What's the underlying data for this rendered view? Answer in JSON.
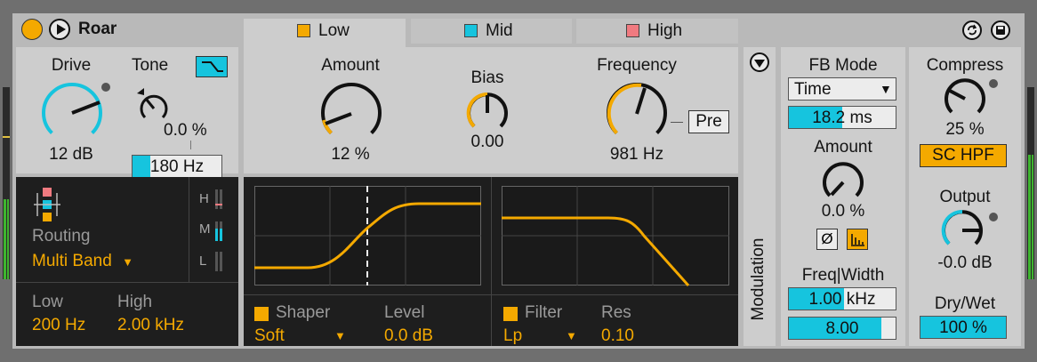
{
  "device": {
    "title": "Roar",
    "colors": {
      "accent_orange": "#f4a900",
      "accent_cyan": "#16c4de",
      "low": "#f4a900",
      "mid": "#16c4de",
      "high": "#f07a80"
    }
  },
  "tabs": [
    {
      "label": "Low",
      "color": "#f4a900"
    },
    {
      "label": "Mid",
      "color": "#16c4de"
    },
    {
      "label": "High",
      "color": "#f07a80"
    }
  ],
  "drive": {
    "label": "Drive",
    "value": "12 dB",
    "level": 0.72
  },
  "tone": {
    "label": "Tone",
    "value": "0.0 %",
    "freq": "180 Hz",
    "freq_level": 0.18
  },
  "band": {
    "amount": {
      "label": "Amount",
      "value": "12 %",
      "level": 0.12
    },
    "bias": {
      "label": "Bias",
      "value": "0.00"
    },
    "frequency": {
      "label": "Frequency",
      "value": "981 Hz",
      "level": 0.55
    },
    "pre_label": "Pre"
  },
  "routing": {
    "label": "Routing",
    "value": "Multi Band",
    "meters": [
      "H",
      "M",
      "L"
    ],
    "low_label": "Low",
    "low_value": "200 Hz",
    "high_label": "High",
    "high_value": "2.00 kHz"
  },
  "shaper": {
    "label": "Shaper",
    "type": "Soft",
    "level_label": "Level",
    "level_value": "0.0 dB"
  },
  "filter": {
    "label": "Filter",
    "type": "Lp",
    "res_label": "Res",
    "res_value": "0.10"
  },
  "modulation": {
    "label": "Modulation"
  },
  "feedback": {
    "mode_label": "FB Mode",
    "mode_value": "Time",
    "time_value": "18.2 ms",
    "time_level": 0.5,
    "amount_label": "Amount",
    "amount_value": "0.0 %",
    "phase_label": "Ø",
    "freqwidth_label": "Freq|Width",
    "freq_value": "1.00 kHz",
    "freq_level": 0.55,
    "width_value": "8.00",
    "width_level": 0.87
  },
  "output": {
    "compress_label": "Compress",
    "compress_value": "25 %",
    "compress_level": 0.25,
    "schpf_label": "SC HPF",
    "output_label": "Output",
    "output_value": "-0.0 dB",
    "output_level": 0.5,
    "drywet_label": "Dry/Wet",
    "drywet_value": "100 %"
  }
}
